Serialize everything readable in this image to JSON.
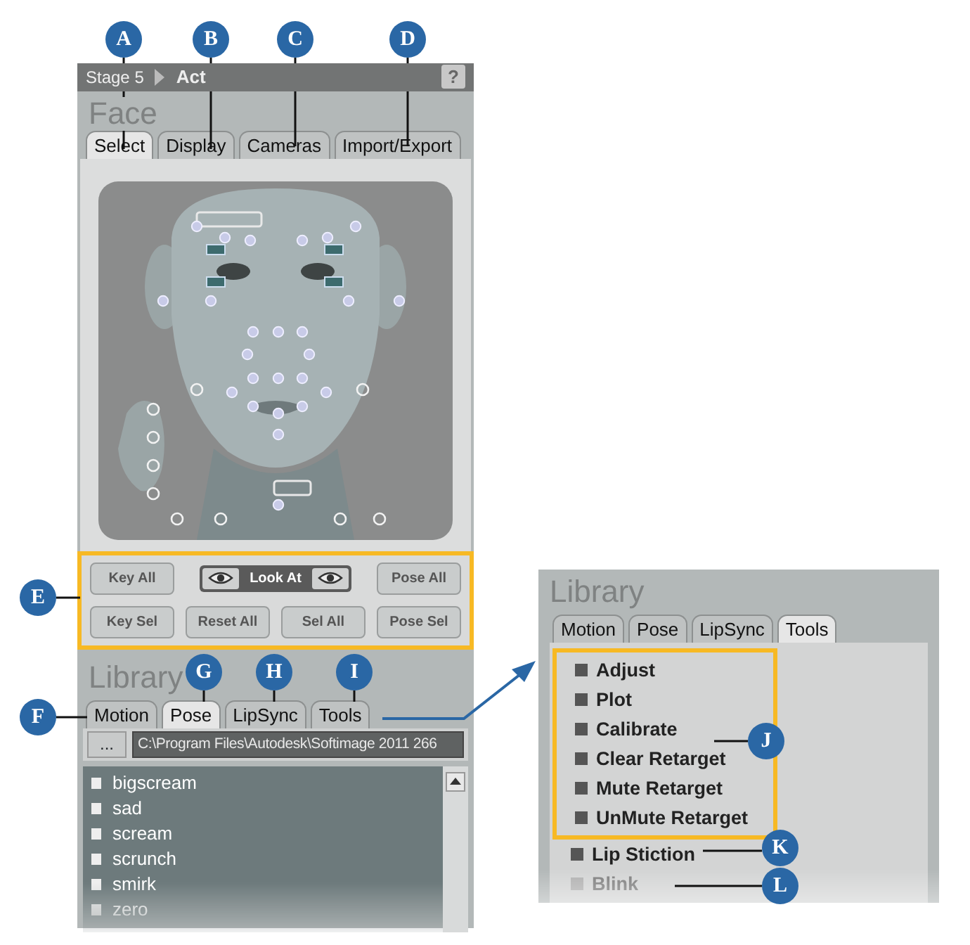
{
  "callouts": [
    {
      "label": "A"
    },
    {
      "label": "B"
    },
    {
      "label": "C"
    },
    {
      "label": "D"
    },
    {
      "label": "E"
    },
    {
      "label": "F"
    },
    {
      "label": "G"
    },
    {
      "label": "H"
    },
    {
      "label": "I"
    },
    {
      "label": "J"
    },
    {
      "label": "K"
    },
    {
      "label": "L"
    }
  ],
  "face_panel": {
    "breadcrumb": [
      "Stage 5",
      "Act"
    ],
    "help": "?",
    "title": "Face",
    "tabs": [
      {
        "label": "Select",
        "selected": true
      },
      {
        "label": "Display",
        "selected": false
      },
      {
        "label": "Cameras",
        "selected": false
      },
      {
        "label": "Import/Export",
        "selected": false
      }
    ],
    "controls_highlighted": true,
    "control_rows": [
      [
        {
          "kind": "button",
          "label": "Key All"
        },
        {
          "kind": "look_at",
          "label": "Look At"
        },
        {
          "kind": "button",
          "label": "Pose All"
        }
      ],
      [
        {
          "kind": "button",
          "label": "Key Sel"
        },
        {
          "kind": "button",
          "label": "Reset All"
        },
        {
          "kind": "button",
          "label": "Sel All"
        },
        {
          "kind": "button",
          "label": "Pose Sel"
        }
      ]
    ]
  },
  "library": {
    "title": "Library",
    "tabs": [
      {
        "label": "Motion",
        "selected": false
      },
      {
        "label": "Pose",
        "selected": true
      },
      {
        "label": "LipSync",
        "selected": false
      },
      {
        "label": "Tools",
        "selected": false
      }
    ],
    "browse_button": "...",
    "path": "C:\\Program Files\\Autodesk\\Softimage 2011 266",
    "items": [
      "bigscream",
      "sad",
      "scream",
      "scrunch",
      "smirk",
      "zero"
    ]
  },
  "tools_library": {
    "title": "Library",
    "tabs": [
      {
        "label": "Motion",
        "selected": false
      },
      {
        "label": "Pose",
        "selected": false
      },
      {
        "label": "LipSync",
        "selected": false
      },
      {
        "label": "Tools",
        "selected": true
      }
    ],
    "items": [
      {
        "label": "Adjust",
        "disabled": false,
        "highlighted": true
      },
      {
        "label": "Plot",
        "disabled": false,
        "highlighted": true
      },
      {
        "label": "Calibrate",
        "disabled": false,
        "highlighted": true
      },
      {
        "label": "Clear Retarget",
        "disabled": false,
        "highlighted": true
      },
      {
        "label": "Mute Retarget",
        "disabled": false,
        "highlighted": true
      },
      {
        "label": "UnMute Retarget",
        "disabled": false,
        "highlighted": true
      },
      {
        "label": "Lip Stiction",
        "disabled": false,
        "highlighted": false
      },
      {
        "label": "Blink",
        "disabled": true,
        "highlighted": false
      }
    ]
  }
}
